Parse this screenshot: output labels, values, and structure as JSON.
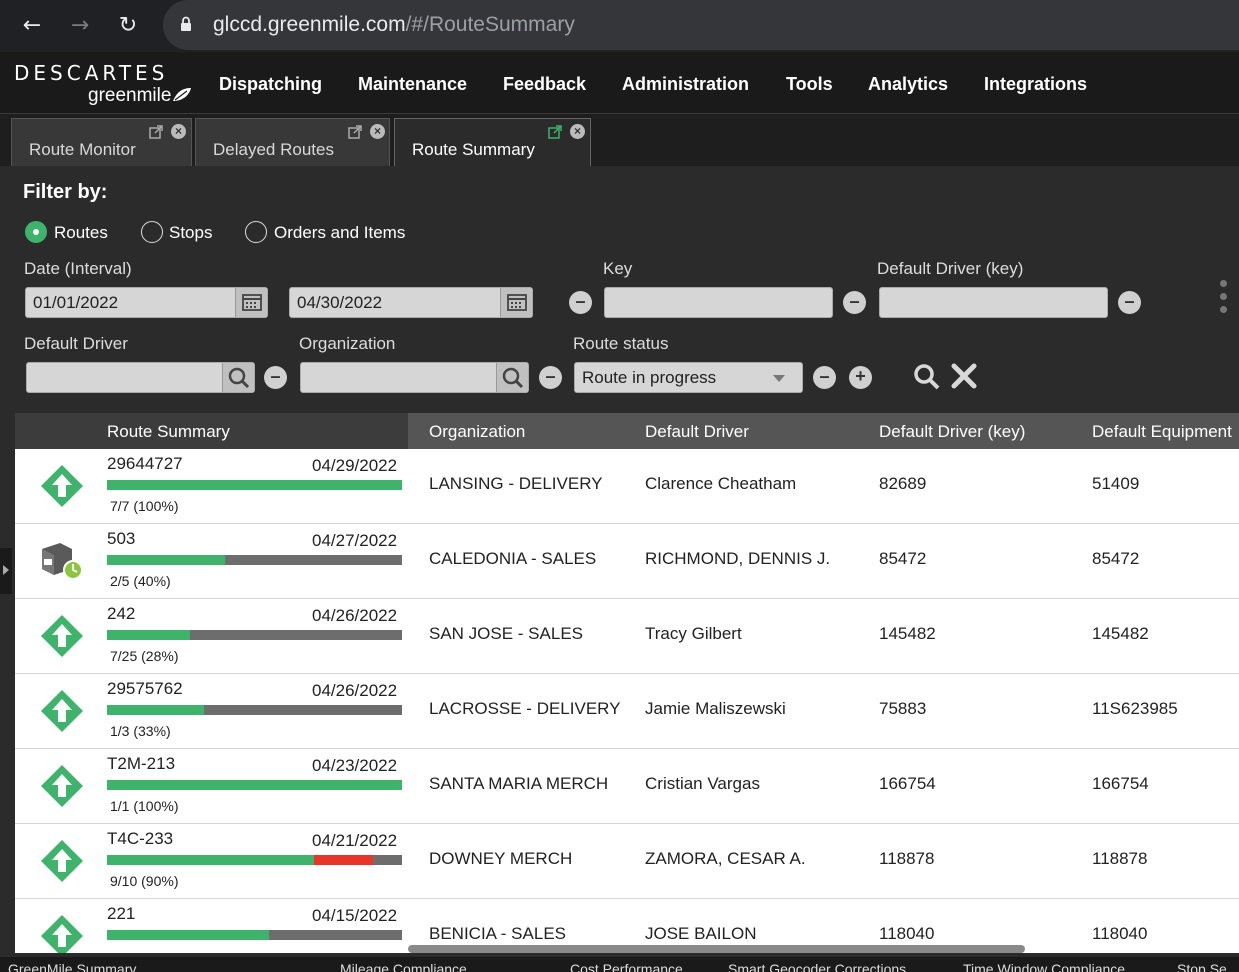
{
  "browser": {
    "url_host": "glccd.greenmile.com",
    "url_path": "/#/RouteSummary"
  },
  "app": {
    "logo_top": "DESCARTES",
    "logo_bottom": "greenmile",
    "menu": [
      "Dispatching",
      "Maintenance",
      "Feedback",
      "Administration",
      "Tools",
      "Analytics",
      "Integrations"
    ]
  },
  "tabs": [
    {
      "label": "Route Monitor"
    },
    {
      "label": "Delayed Routes"
    },
    {
      "label": "Route Summary"
    }
  ],
  "filter": {
    "title": "Filter by:",
    "radios": [
      {
        "label": "Routes",
        "selected": true
      },
      {
        "label": "Stops",
        "selected": false
      },
      {
        "label": "Orders and Items",
        "selected": false
      }
    ],
    "date_label": "Date (Interval)",
    "date_from": "01/01/2022",
    "date_to": "04/30/2022",
    "key_label": "Key",
    "key_value": "",
    "default_driver_key_label": "Default Driver (key)",
    "default_driver_key_value": "",
    "default_driver_label": "Default Driver",
    "default_driver_value": "",
    "organization_label": "Organization",
    "organization_value": "",
    "route_status_label": "Route status",
    "route_status_value": "Route in progress"
  },
  "grid": {
    "columns": [
      "Route Summary",
      "Organization",
      "Default Driver",
      "Default Driver (key)",
      "Default Equipment"
    ],
    "rows": [
      {
        "id": "29644727",
        "date": "04/29/2022",
        "progress": "7/7 (100%)",
        "green": 1.0,
        "red": 0,
        "icon": "up-arrow-diamond-icon",
        "org": "LANSING - DELIVERY",
        "driver": "Clarence Cheatham",
        "driver_key": "82689",
        "equipment": "51409"
      },
      {
        "id": "503",
        "date": "04/27/2022",
        "progress": "2/5 (40%)",
        "green": 0.4,
        "red": 0,
        "icon": "truck-clock-icon",
        "org": "CALEDONIA - SALES",
        "driver": "RICHMOND, DENNIS J.",
        "driver_key": "85472",
        "equipment": "85472"
      },
      {
        "id": "242",
        "date": "04/26/2022",
        "progress": "7/25 (28%)",
        "green": 0.28,
        "red": 0,
        "icon": "up-arrow-diamond-icon",
        "org": "SAN JOSE - SALES",
        "driver": "Tracy Gilbert",
        "driver_key": "145482",
        "equipment": "145482"
      },
      {
        "id": "29575762",
        "date": "04/26/2022",
        "progress": "1/3 (33%)",
        "green": 0.33,
        "red": 0,
        "icon": "up-arrow-diamond-icon",
        "org": "LACROSSE - DELIVERY",
        "driver": "Jamie Maliszewski",
        "driver_key": "75883",
        "equipment": "11S623985"
      },
      {
        "id": "T2M-213",
        "date": "04/23/2022",
        "progress": "1/1 (100%)",
        "green": 1.0,
        "red": 0,
        "icon": "up-arrow-diamond-icon",
        "org": "SANTA MARIA MERCH",
        "driver": "Cristian Vargas",
        "driver_key": "166754",
        "equipment": "166754"
      },
      {
        "id": "T4C-233",
        "date": "04/21/2022",
        "progress": "9/10 (90%)",
        "green": 0.7,
        "red": 0.2,
        "icon": "up-arrow-diamond-icon",
        "org": "DOWNEY MERCH",
        "driver": "ZAMORA, CESAR A.",
        "driver_key": "118878",
        "equipment": "118878"
      },
      {
        "id": "221",
        "date": "04/15/2022",
        "progress": "",
        "green": 0.55,
        "red": 0,
        "icon": "up-arrow-diamond-icon",
        "org": "BENICIA - SALES",
        "driver": "JOSE BAILON",
        "driver_key": "118040",
        "equipment": "118040"
      }
    ]
  },
  "footer": [
    "GreenMile Summary",
    "Mileage Compliance",
    "Cost Performance",
    "Smart Geocoder Corrections",
    "Time Window Compliance",
    "Stop Se"
  ]
}
